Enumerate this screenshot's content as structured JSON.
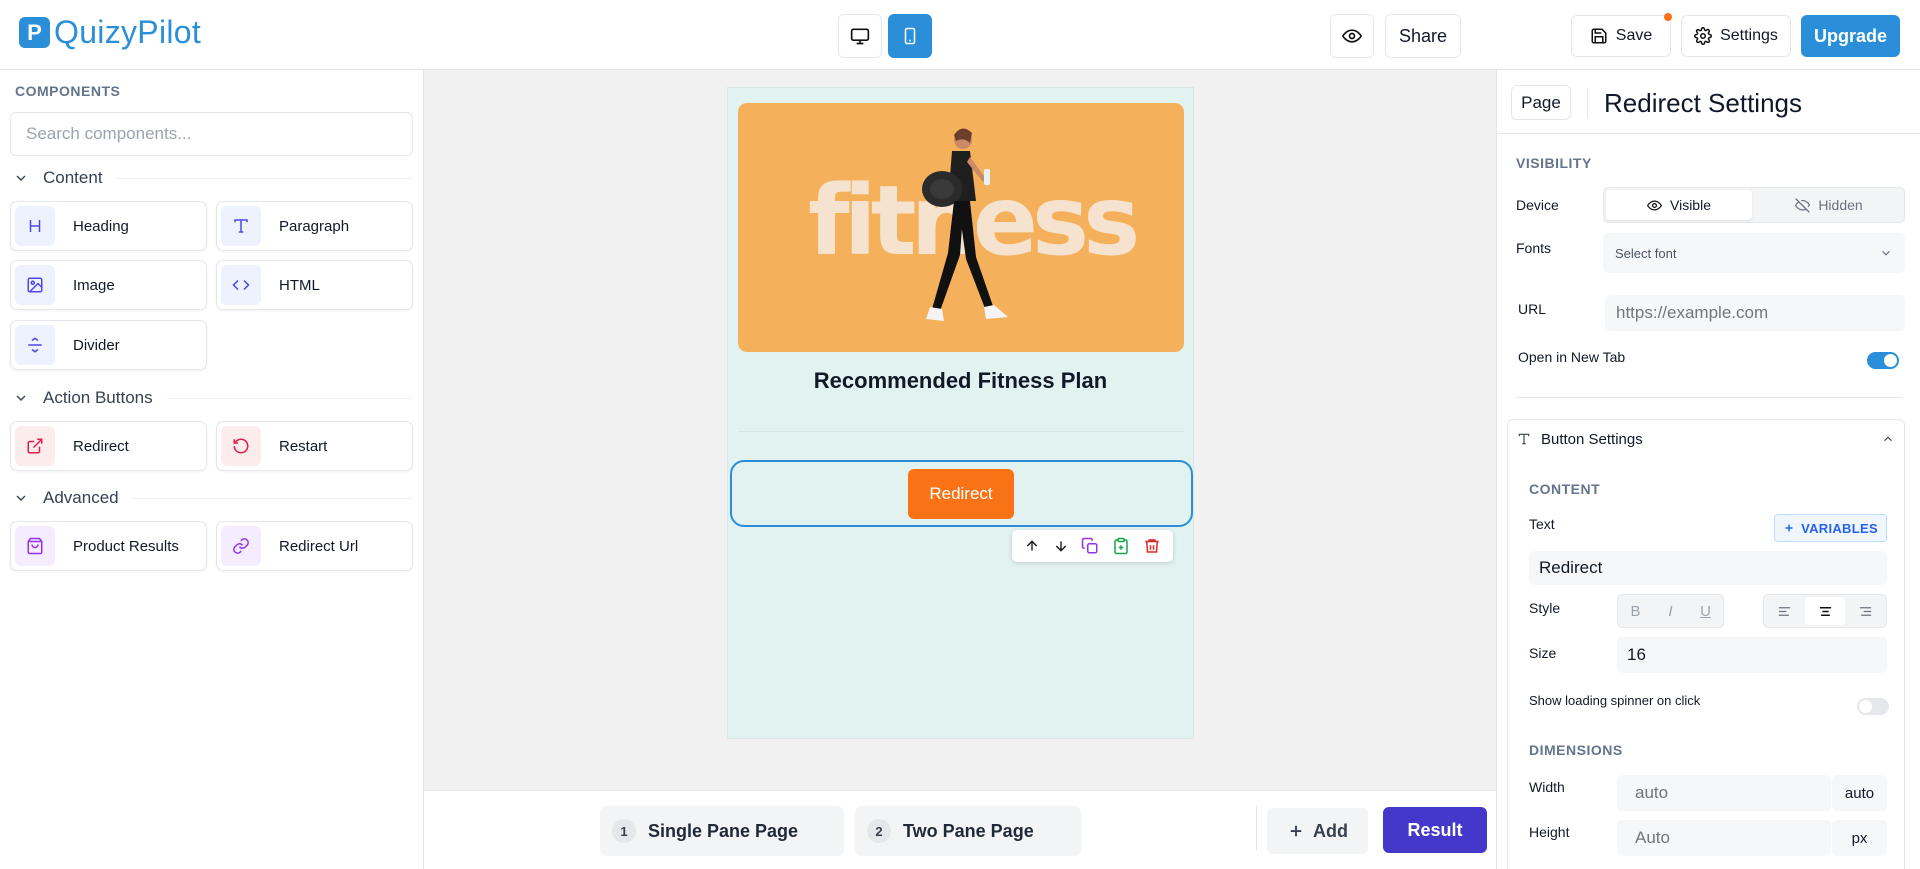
{
  "app": {
    "logo_letter": "P",
    "name": "QuizyPilot",
    "brand_color": "#2a8fd8",
    "accent_orange": "#f97316",
    "result_color": "#4338ca"
  },
  "toolbar": {
    "desktop_icon": "monitor-icon",
    "mobile_icon": "smartphone-icon",
    "preview_icon": "eye-icon",
    "share_label": "Share",
    "save_label": "Save",
    "settings_label": "Settings",
    "upgrade_label": "Upgrade"
  },
  "sidebar": {
    "title": "COMPONENTS",
    "search_placeholder": "Search components...",
    "sections": [
      {
        "label": "Content",
        "items": [
          {
            "label": "Heading",
            "icon": "heading-icon"
          },
          {
            "label": "Paragraph",
            "icon": "type-icon"
          },
          {
            "label": "Image",
            "icon": "image-icon"
          },
          {
            "label": "HTML",
            "icon": "code-icon"
          },
          {
            "label": "Divider",
            "icon": "divider-icon"
          }
        ]
      },
      {
        "label": "Action Buttons",
        "items": [
          {
            "label": "Redirect",
            "icon": "external-link-icon"
          },
          {
            "label": "Restart",
            "icon": "restart-icon"
          }
        ]
      },
      {
        "label": "Advanced",
        "items": [
          {
            "label": "Product Results",
            "icon": "shopping-bag-icon"
          },
          {
            "label": "Redirect Url",
            "icon": "link-icon"
          }
        ]
      }
    ]
  },
  "canvas": {
    "hero_word": "fitness",
    "plan_title": "Recommended Fitness Plan",
    "button_label": "Redirect"
  },
  "pages": {
    "tabs": [
      {
        "num": "1",
        "label": "Single Pane Page"
      },
      {
        "num": "2",
        "label": "Two Pane Page"
      }
    ],
    "add_label": "Add",
    "result_label": "Result"
  },
  "panel": {
    "page_button": "Page",
    "title": "Redirect Settings",
    "visibility_caption": "VISIBILITY",
    "device_label": "Device",
    "visible_label": "Visible",
    "hidden_label": "Hidden",
    "fonts_label": "Fonts",
    "font_placeholder": "Select font",
    "url_label": "URL",
    "url_placeholder": "https://example.com",
    "new_tab_label": "Open in New Tab",
    "new_tab_on": true,
    "button_settings_label": "Button Settings",
    "content_caption": "CONTENT",
    "text_label": "Text",
    "variables_label": "VARIABLES",
    "text_value": "Redirect",
    "style_label": "Style",
    "style_bold": "B",
    "style_italic": "I",
    "style_underline": "U",
    "align_selected": "center",
    "size_label": "Size",
    "size_value": "16",
    "spinner_label": "Show loading spinner on click",
    "spinner_on": false,
    "dimensions_caption": "DIMENSIONS",
    "width_label": "Width",
    "width_placeholder": "auto",
    "width_unit": "auto",
    "height_label": "Height",
    "height_placeholder": "Auto",
    "height_unit": "px"
  }
}
